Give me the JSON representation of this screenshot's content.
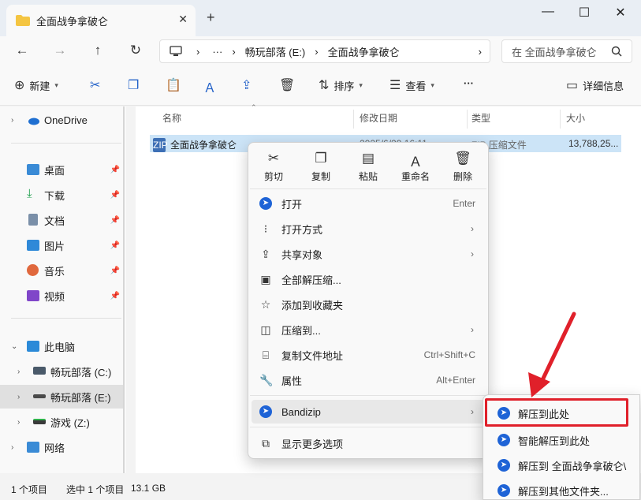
{
  "window": {
    "tab_title": "全面战争拿破仑",
    "new_tab": "+",
    "minimize": "—",
    "maximize": "☐",
    "close": "✕"
  },
  "address": {
    "breadcrumb_more": "···",
    "drive": "畅玩部落 (E:)",
    "folder": "全面战争拿破仑",
    "search_placeholder": "在 全面战争拿破仑"
  },
  "toolbar": {
    "new_label": "新建",
    "sort_label": "排序",
    "view_label": "查看",
    "more_label": "···",
    "details_label": "详细信息"
  },
  "sidebar": {
    "onedrive": "OneDrive",
    "quick": [
      {
        "label": "桌面",
        "icon": "desktop-icon"
      },
      {
        "label": "下载",
        "icon": "download-icon"
      },
      {
        "label": "文档",
        "icon": "document-icon"
      },
      {
        "label": "图片",
        "icon": "pictures-icon"
      },
      {
        "label": "音乐",
        "icon": "music-icon"
      },
      {
        "label": "视频",
        "icon": "video-icon"
      }
    ],
    "this_pc": "此电脑",
    "drives": [
      {
        "label": "畅玩部落 (C:)"
      },
      {
        "label": "畅玩部落 (E:)"
      },
      {
        "label": "游戏 (Z:)"
      }
    ],
    "network": "网络"
  },
  "columns": {
    "name": "名称",
    "modified": "修改日期",
    "type": "类型",
    "size": "大小"
  },
  "file": {
    "name": "全面战争拿破仑",
    "modified": "2025/6/29 16:11",
    "type": "ZIP 压缩文件",
    "size": "13,788,25..."
  },
  "context_menu": {
    "quick_actions": [
      {
        "label": "剪切",
        "icon": "cut-icon"
      },
      {
        "label": "复制",
        "icon": "copy-icon"
      },
      {
        "label": "粘贴",
        "icon": "paste-icon"
      },
      {
        "label": "重命名",
        "icon": "rename-icon"
      },
      {
        "label": "删除",
        "icon": "delete-icon"
      }
    ],
    "open": "打开",
    "open_key": "Enter",
    "open_with": "打开方式",
    "share": "共享对象",
    "extract_all": "全部解压缩...",
    "favorites": "添加到收藏夹",
    "compress_to": "压缩到...",
    "copy_path": "复制文件地址",
    "copy_path_key": "Ctrl+Shift+C",
    "properties": "属性",
    "properties_key": "Alt+Enter",
    "bandizip": "Bandizip",
    "more_options": "显示更多选项"
  },
  "submenu": {
    "items": [
      "解压到此处",
      "智能解压到此处",
      "解压到 全面战争拿破仑\\",
      "解压到其他文件夹..."
    ]
  },
  "status": {
    "count": "1 个项目",
    "selected": "选中 1 个项目",
    "size": "13.1 GB"
  },
  "colors": {
    "accent": "#1e63d6",
    "highlight_box": "#e0202a",
    "selection": "#cce4f7"
  }
}
